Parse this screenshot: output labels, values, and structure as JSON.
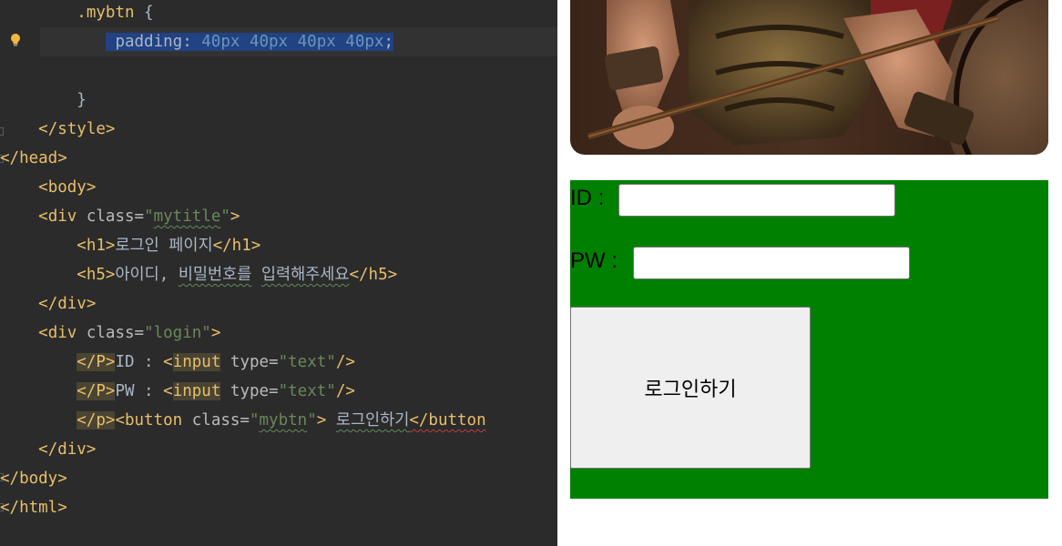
{
  "editor": {
    "lines": [
      [
        {
          "t": "        "
        },
        {
          "t": ".mybtn",
          "c": "css-sel"
        },
        {
          "t": " {",
          "c": "punct"
        }
      ],
      [
        {
          "t": "           "
        },
        {
          "t": " padding: ",
          "c": "css-prop hl-sel"
        },
        {
          "t": "40px 40px 40px 40px",
          "c": "css-num hl-sel"
        },
        {
          "t": ";",
          "c": "punct hl-sel"
        }
      ],
      [
        {
          "t": ""
        }
      ],
      [
        {
          "t": "        "
        },
        {
          "t": "}",
          "c": "punct"
        }
      ],
      [
        {
          "t": "    "
        },
        {
          "t": "</style>",
          "c": "tag"
        }
      ],
      [
        {
          "t": "</head>",
          "c": "tag"
        }
      ],
      [
        {
          "t": "    "
        },
        {
          "t": "<body>",
          "c": "tag"
        }
      ],
      [
        {
          "t": "    "
        },
        {
          "t": "<div ",
          "c": "tag"
        },
        {
          "t": "class=",
          "c": "attr"
        },
        {
          "t": "\"",
          "c": "str"
        },
        {
          "t": "mytitle",
          "c": "str wavy-green"
        },
        {
          "t": "\"",
          "c": "str"
        },
        {
          "t": ">",
          "c": "tag"
        }
      ],
      [
        {
          "t": "        "
        },
        {
          "t": "<h1>",
          "c": "tag"
        },
        {
          "t": "로그인 페이지"
        },
        {
          "t": "</h1>",
          "c": "tag"
        }
      ],
      [
        {
          "t": "        "
        },
        {
          "t": "<h5>",
          "c": "tag"
        },
        {
          "t": "아이디, "
        },
        {
          "t": "비밀번호를",
          "c": "wavy-green"
        },
        {
          "t": " "
        },
        {
          "t": "입력해주세요",
          "c": "wavy-green"
        },
        {
          "t": "</h5>",
          "c": "tag"
        }
      ],
      [
        {
          "t": "    "
        },
        {
          "t": "</div>",
          "c": "tag"
        }
      ],
      [
        {
          "t": "    "
        },
        {
          "t": "<div ",
          "c": "tag"
        },
        {
          "t": "class=",
          "c": "attr"
        },
        {
          "t": "\"login\"",
          "c": "str"
        },
        {
          "t": ">",
          "c": "tag"
        }
      ],
      [
        {
          "t": "        "
        },
        {
          "t": "</P>",
          "c": "tag hl-tag"
        },
        {
          "t": "ID : "
        },
        {
          "t": "<",
          "c": "tag"
        },
        {
          "t": "input",
          "c": "tag hl-tag"
        },
        {
          "t": " type=",
          "c": "attr"
        },
        {
          "t": "\"text\"",
          "c": "str"
        },
        {
          "t": "/>",
          "c": "tag"
        }
      ],
      [
        {
          "t": "        "
        },
        {
          "t": "</P>",
          "c": "tag hl-tag"
        },
        {
          "t": "PW : "
        },
        {
          "t": "<",
          "c": "tag"
        },
        {
          "t": "input",
          "c": "tag hl-tag"
        },
        {
          "t": " type=",
          "c": "attr"
        },
        {
          "t": "\"text\"",
          "c": "str"
        },
        {
          "t": "/>",
          "c": "tag"
        }
      ],
      [
        {
          "t": "        "
        },
        {
          "t": "</p>",
          "c": "tag hl-tag"
        },
        {
          "t": "<button ",
          "c": "tag"
        },
        {
          "t": "class=",
          "c": "attr"
        },
        {
          "t": "\"",
          "c": "str"
        },
        {
          "t": "mybtn",
          "c": "str wavy-green"
        },
        {
          "t": "\"",
          "c": "str"
        },
        {
          "t": ">",
          "c": "tag"
        },
        {
          "t": " "
        },
        {
          "t": "로그인하기",
          "c": "wavy-green"
        },
        {
          "t": "</button",
          "c": "tag wavy-red"
        }
      ],
      [
        {
          "t": "    "
        },
        {
          "t": "</div>",
          "c": "tag"
        }
      ],
      [
        {
          "t": "</body>",
          "c": "tag"
        }
      ],
      [
        {
          "t": "</html>",
          "c": "tag"
        }
      ]
    ]
  },
  "preview": {
    "id_label": "ID :",
    "pw_label": "PW :",
    "id_value": "",
    "pw_value": "",
    "button_label": "로그인하기",
    "box_color": "#008000"
  }
}
